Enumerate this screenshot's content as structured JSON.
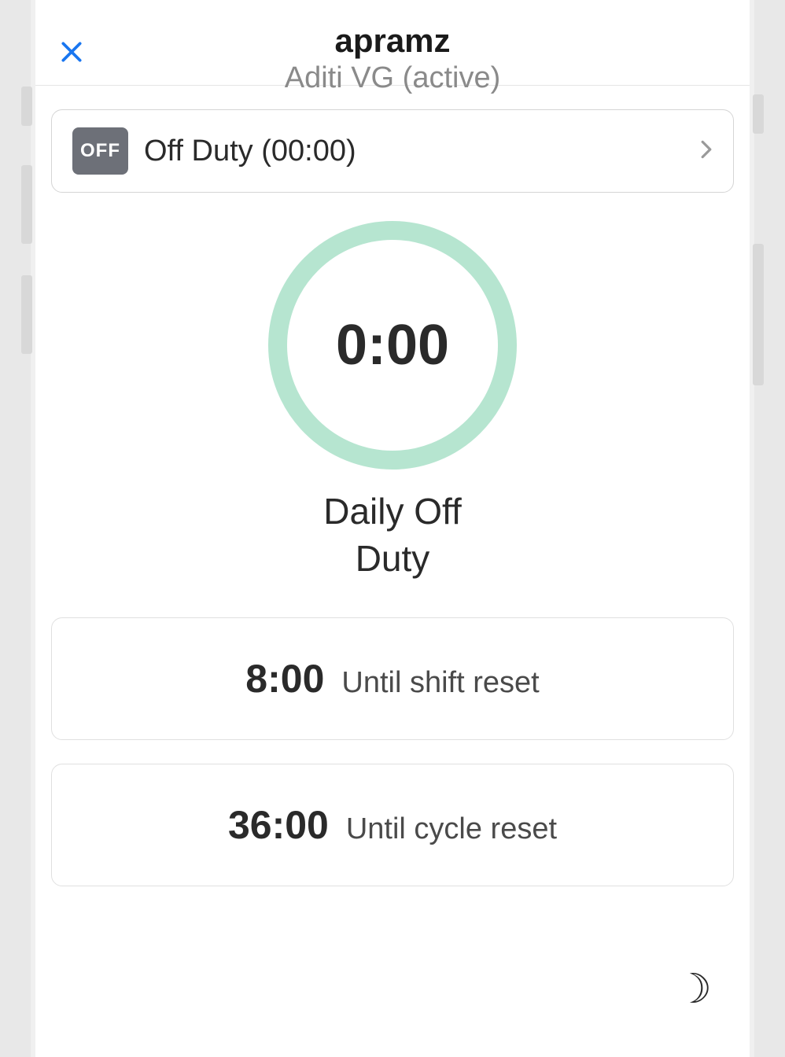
{
  "header": {
    "title": "apramz",
    "subtitle": "Aditi VG (active)"
  },
  "status": {
    "badge": "OFF",
    "text": "Off Duty (00:00)"
  },
  "dial": {
    "time": "0:00",
    "label": "Daily Off Duty"
  },
  "resets": [
    {
      "time": "8:00",
      "label": "Until shift reset"
    },
    {
      "time": "36:00",
      "label": "Until cycle reset"
    }
  ]
}
